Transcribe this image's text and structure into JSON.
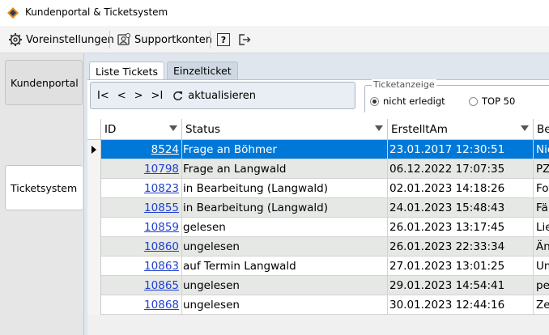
{
  "window": {
    "title": "Kundenportal & Ticketsystem"
  },
  "toolbar": {
    "settings_label": "Voreinstellungen",
    "support_label": "Supportkonten",
    "help_label": "?"
  },
  "sidebar": {
    "items": [
      {
        "label": "Kundenportal"
      },
      {
        "label": "Ticketsystem"
      }
    ]
  },
  "tabs": [
    {
      "label": "Liste Tickets"
    },
    {
      "label": "Einzelticket"
    }
  ],
  "nav": {
    "first": "I<",
    "prev": "<",
    "next": ">",
    "last": ">I",
    "refresh_label": "aktualisieren"
  },
  "ticketanzeige": {
    "legend": "Ticketanzeige",
    "option_open": "nicht erledigt",
    "option_top": "TOP 50",
    "selected": "nicht erledigt"
  },
  "grid": {
    "columns": [
      "ID",
      "Status",
      "ErstelltAm",
      "Bet"
    ],
    "rows": [
      {
        "id": "8524",
        "status": "Frage an Böhmer",
        "created": "23.01.2017 12:30:51",
        "bet": "Nic"
      },
      {
        "id": "10798",
        "status": "Frage an Langwald",
        "created": "06.12.2022 17:07:35",
        "bet": "PZl"
      },
      {
        "id": "10823",
        "status": "in Bearbeitung (Langwald)",
        "created": "02.01.2023 14:18:26",
        "bet": "Fot"
      },
      {
        "id": "10855",
        "status": "in Bearbeitung (Langwald)",
        "created": "24.01.2023 15:48:43",
        "bet": "Fäll"
      },
      {
        "id": "10859",
        "status": "gelesen",
        "created": "26.01.2023 13:17:45",
        "bet": "Lie"
      },
      {
        "id": "10860",
        "status": "ungelesen",
        "created": "26.01.2023 22:33:34",
        "bet": "Äne"
      },
      {
        "id": "10863",
        "status": "auf Termin Langwald",
        "created": "27.01.2023 13:01:25",
        "bet": "Um"
      },
      {
        "id": "10865",
        "status": "ungelesen",
        "created": "29.01.2023 14:54:41",
        "bet": "per"
      },
      {
        "id": "10868",
        "status": "ungelesen",
        "created": "30.01.2023 12:44:16",
        "bet": "Zei"
      }
    ]
  },
  "colors": {
    "selection": "#0078d7",
    "link": "#1f3fd0",
    "alt_row": "#e5e8e5"
  }
}
